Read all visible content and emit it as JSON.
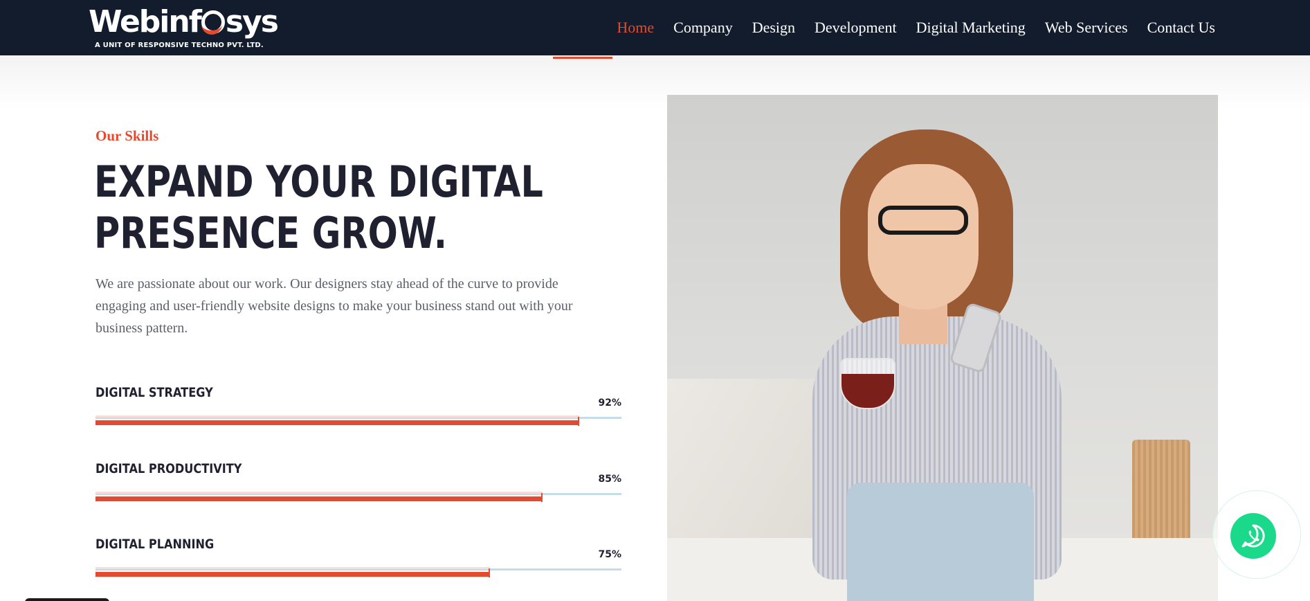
{
  "header": {
    "logo": {
      "text_before": "Webinf",
      "text_after": "sys",
      "tagline": "A UNIT OF RESPONSIVE TECHNO PVT. LTD."
    },
    "nav": [
      {
        "label": "Home",
        "active": true
      },
      {
        "label": "Company",
        "active": false
      },
      {
        "label": "Design",
        "active": false
      },
      {
        "label": "Development",
        "active": false
      },
      {
        "label": "Digital Marketing",
        "active": false
      },
      {
        "label": "Web Services",
        "active": false
      },
      {
        "label": "Contact Us",
        "active": false
      }
    ]
  },
  "skills_section": {
    "kicker": "Our Skills",
    "headline_line1": "EXPAND YOUR DIGITAL",
    "headline_line2": "PRESENCE GROW.",
    "paragraph": "We are passionate about our work. Our designers stay ahead of the curve to provide engaging and user-friendly website designs to make your business stand out with your business pattern.",
    "skills": [
      {
        "label": "DIGITAL STRATEGY",
        "percent_text": "92%",
        "percent": 92
      },
      {
        "label": "DIGITAL PRODUCTIVITY",
        "percent_text": "85%",
        "percent": 85
      },
      {
        "label": "DIGITAL PLANNING",
        "percent_text": "75%",
        "percent": 75
      }
    ]
  },
  "widgets": {
    "whatsapp_icon": "whatsapp-icon"
  },
  "colors": {
    "header_bg": "#121c2c",
    "accent": "#e64a2e",
    "heading": "#1f2130",
    "body_text": "#5c5f6a",
    "track": "#c4dce8",
    "whatsapp": "#1bd98a"
  }
}
